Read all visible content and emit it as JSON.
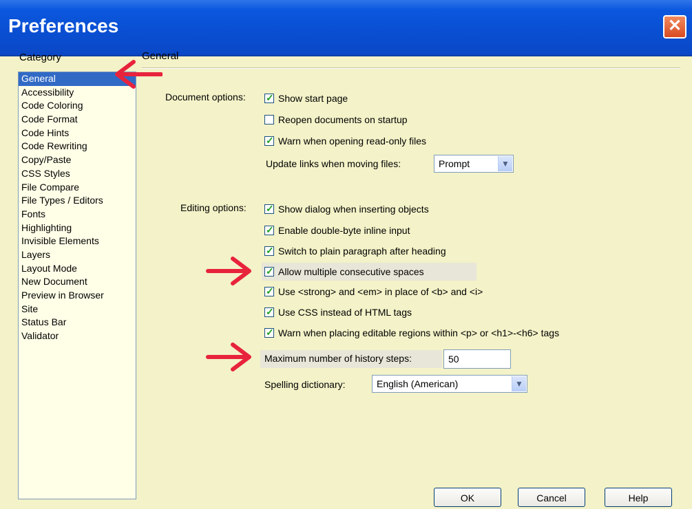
{
  "window": {
    "title": "Preferences",
    "close_glyph": "✕"
  },
  "category": {
    "label": "Category",
    "items": [
      "General",
      "Accessibility",
      "Code Coloring",
      "Code Format",
      "Code Hints",
      "Code Rewriting",
      "Copy/Paste",
      "CSS Styles",
      "File Compare",
      "File Types / Editors",
      "Fonts",
      "Highlighting",
      "Invisible Elements",
      "Layers",
      "Layout Mode",
      "New Document",
      "Preview in Browser",
      "Site",
      "Status Bar",
      "Validator"
    ],
    "selected": "General"
  },
  "panel": {
    "section_title": "General",
    "document_options": {
      "label": "Document options:",
      "show_start_page": {
        "label": "Show start page",
        "checked": true
      },
      "reopen_documents": {
        "label": "Reopen documents on startup",
        "checked": false
      },
      "warn_read_only": {
        "label": "Warn when opening read-only files",
        "checked": true
      },
      "update_links": {
        "label": "Update links when moving files:",
        "value": "Prompt"
      }
    },
    "editing_options": {
      "label": "Editing options:",
      "show_dialog": {
        "label": "Show dialog when inserting objects",
        "checked": true
      },
      "double_byte": {
        "label": "Enable double-byte inline input",
        "checked": true
      },
      "plain_paragraph": {
        "label": "Switch to plain paragraph after heading",
        "checked": true
      },
      "multiple_spaces": {
        "label": "Allow multiple consecutive spaces",
        "checked": true
      },
      "strong_em": {
        "label": "Use <strong> and <em> in place of <b> and <i>",
        "checked": true
      },
      "use_css": {
        "label": "Use CSS instead of HTML tags",
        "checked": true
      },
      "warn_editable": {
        "label": "Warn when placing editable regions within <p> or <h1>-<h6> tags",
        "checked": true
      }
    },
    "history_steps": {
      "label": "Maximum number of history steps:",
      "value": "50"
    },
    "spelling": {
      "label": "Spelling dictionary:",
      "value": "English (American)"
    }
  },
  "buttons": {
    "ok": "OK",
    "cancel": "Cancel",
    "help": "Help"
  },
  "colors": {
    "annotation_arrow": "#e8233c",
    "title_bar": "#0a4fd3",
    "window_bg": "#f3f2c8",
    "selection": "#316ac5"
  },
  "icons": {
    "check": "✓",
    "dropdown": "▼"
  }
}
